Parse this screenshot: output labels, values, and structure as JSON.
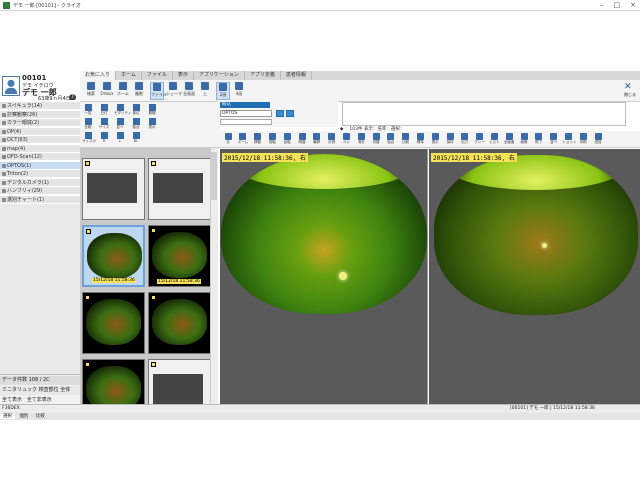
{
  "window": {
    "title": "デモ  一郎 [00101] - クライオ"
  },
  "patient": {
    "id": "00101",
    "kana": "デモ  イチロウ",
    "name": "デモ  一郎",
    "age": "63歳9ヵ月4日",
    "age_badge": "?"
  },
  "ribbon_tabs": [
    "お気に入り",
    "ホーム",
    "ファイル",
    "表示",
    "アプリケーション",
    "アプリ定義",
    "患者情報"
  ],
  "ribbon_buttons": [
    "検索",
    "Orbisx",
    "ホーム",
    "複数",
    "ファイル",
    "シェーマ",
    "全画面",
    "上",
    "2画",
    "4画"
  ],
  "close_label": "閉じる",
  "sidebar": {
    "items": [
      "スペキュラ(14)",
      "診察観察(26)",
      "カラー眼底(2)",
      "OP(4)",
      "OCT(63)",
      "map(4)",
      "OFD-Scan(12)",
      "OPTOS(1)",
      "Triton(2)",
      "デジタルカメラ(1)",
      "ハンフリィ(29)",
      "選別チャート(1)"
    ],
    "selected": 7,
    "data_count": "データ件数 108 / 2C",
    "tree_labels": [
      "ミニタリュック",
      "検査部位",
      "全体"
    ],
    "footer_buttons": [
      "全て表示",
      "全て非表示"
    ]
  },
  "tool_panel": {
    "row1": [
      "一覧",
      "日付",
      "モダリティ",
      "部位",
      "期間"
    ],
    "row2": [
      "比較",
      "サイズ",
      "並べ",
      "結合",
      "表示"
    ],
    "row3": [
      "サイズ小",
      "R",
      "L",
      "RL"
    ]
  },
  "filter": {
    "header": "絞込",
    "value": "OPTOS"
  },
  "info_line": "◆ ：103件 表示：倍率：選択：",
  "view_tools": [
    "元",
    "ズーム",
    "移動",
    "回転",
    "反転",
    "明度",
    "輪郭",
    "計測",
    "ペン",
    "消去",
    "切替",
    "結合",
    "比較",
    "標準",
    "表示",
    "保存",
    "出力",
    "グレー",
    "ヒスト",
    "全画面",
    "画像",
    "終了",
    "並べ",
    "ショット",
    "印刷",
    "送信"
  ],
  "thumbnails": [
    {
      "caption": "",
      "kind": "doc"
    },
    {
      "caption": "",
      "kind": "doc"
    },
    {
      "caption": "15/12/18 11:58:36",
      "kind": "fundus",
      "selected": true
    },
    {
      "caption": "15/12/18 11:58:36",
      "kind": "fundus"
    },
    {
      "caption": "",
      "kind": "fundus"
    },
    {
      "caption": "",
      "kind": "fundus"
    },
    {
      "caption": "",
      "kind": "fundus"
    },
    {
      "caption": "",
      "kind": "doc"
    }
  ],
  "viewer": {
    "left_stamp": "2015/12/18 11:58:36, 右",
    "right_stamp": "2015/12/18 11:58:36, 右"
  },
  "status": {
    "left": "F36DEX",
    "right": "[00101] デモ  一郎 | 15/12/18 11:58:36"
  },
  "bottom_tabs": [
    "選択",
    "個別",
    "比較"
  ]
}
